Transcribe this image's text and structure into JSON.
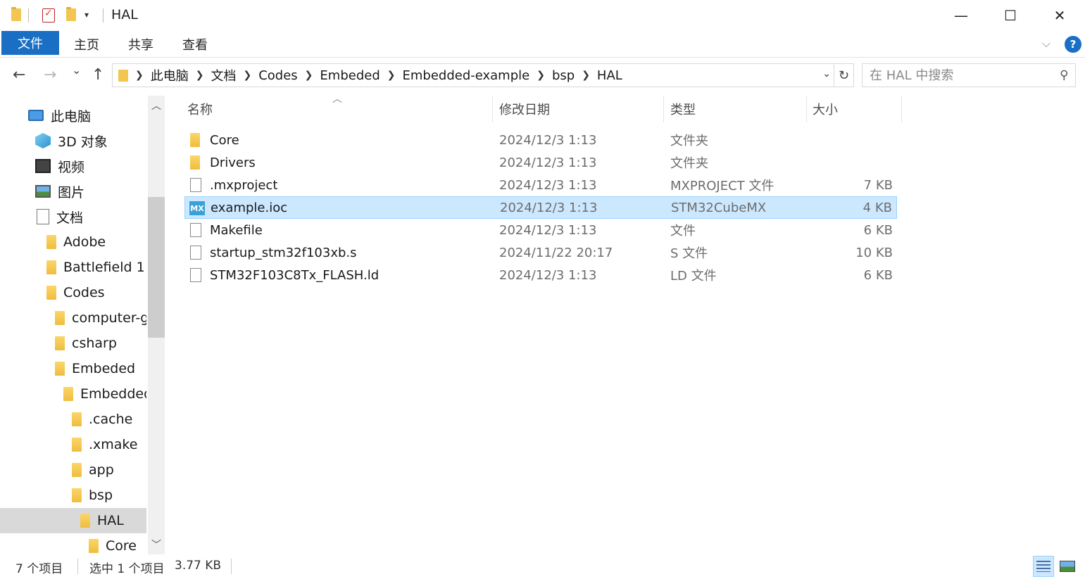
{
  "window": {
    "title": "HAL",
    "minimize": "—",
    "maximize": "☐",
    "close": "✕"
  },
  "ribbon": {
    "tabs": [
      "文件",
      "主页",
      "共享",
      "查看"
    ]
  },
  "nav": {
    "back": "←",
    "forward": "→",
    "recent": "⌄",
    "up": "↑",
    "breadcrumb": [
      "此电脑",
      "文档",
      "Codes",
      "Embeded",
      "Embedded-example",
      "bsp",
      "HAL"
    ],
    "search_placeholder": "在 HAL 中搜索",
    "refresh": "↻"
  },
  "sidebar": {
    "items": [
      {
        "label": "此电脑",
        "icon": "pc-icon"
      },
      {
        "label": "3D 对象",
        "icon": "3d-objects-icon"
      },
      {
        "label": "视频",
        "icon": "video-icon"
      },
      {
        "label": "图片",
        "icon": "pictures-icon"
      },
      {
        "label": "文档",
        "icon": "documents-icon"
      },
      {
        "label": "Adobe",
        "icon": "folder-icon"
      },
      {
        "label": "Battlefield 1",
        "icon": "folder-icon"
      },
      {
        "label": "Codes",
        "icon": "folder-icon"
      },
      {
        "label": "computer-graphics",
        "icon": "folder-icon"
      },
      {
        "label": "csharp",
        "icon": "folder-icon"
      },
      {
        "label": "Embeded",
        "icon": "folder-icon"
      },
      {
        "label": "Embedded-example",
        "icon": "folder-icon"
      },
      {
        "label": ".cache",
        "icon": "folder-icon"
      },
      {
        "label": ".xmake",
        "icon": "folder-icon"
      },
      {
        "label": "app",
        "icon": "folder-icon"
      },
      {
        "label": "bsp",
        "icon": "folder-icon"
      },
      {
        "label": "HAL",
        "icon": "folder-icon",
        "selected": true
      },
      {
        "label": "Core",
        "icon": "folder-icon"
      }
    ]
  },
  "columns": {
    "name": "名称",
    "date": "修改日期",
    "type": "类型",
    "size": "大小"
  },
  "files": [
    {
      "name": "Core",
      "date": "2024/12/3 1:13",
      "type": "文件夹",
      "size": "",
      "icon": "folder-icon"
    },
    {
      "name": "Drivers",
      "date": "2024/12/3 1:13",
      "type": "文件夹",
      "size": "",
      "icon": "folder-icon"
    },
    {
      "name": ".mxproject",
      "date": "2024/12/3 1:13",
      "type": "MXPROJECT 文件",
      "size": "7 KB",
      "icon": "file-icon"
    },
    {
      "name": "example.ioc",
      "date": "2024/12/3 1:13",
      "type": "STM32CubeMX",
      "size": "4 KB",
      "icon": "stm32cubemx-icon",
      "selected": true,
      "icon_text": "MX"
    },
    {
      "name": "Makefile",
      "date": "2024/12/3 1:13",
      "type": "文件",
      "size": "6 KB",
      "icon": "file-icon"
    },
    {
      "name": "startup_stm32f103xb.s",
      "date": "2024/11/22 20:17",
      "type": "S 文件",
      "size": "10 KB",
      "icon": "file-icon"
    },
    {
      "name": "STM32F103C8Tx_FLASH.ld",
      "date": "2024/12/3 1:13",
      "type": "LD 文件",
      "size": "6 KB",
      "icon": "file-icon"
    }
  ],
  "status": {
    "item_count": "7 个项目",
    "selection": "选中 1 个项目",
    "selection_size": "3.77 KB"
  },
  "colors": {
    "accent": "#1a6fc4",
    "selection_bg": "#cce8ff",
    "selection_border": "#99d1ff"
  }
}
